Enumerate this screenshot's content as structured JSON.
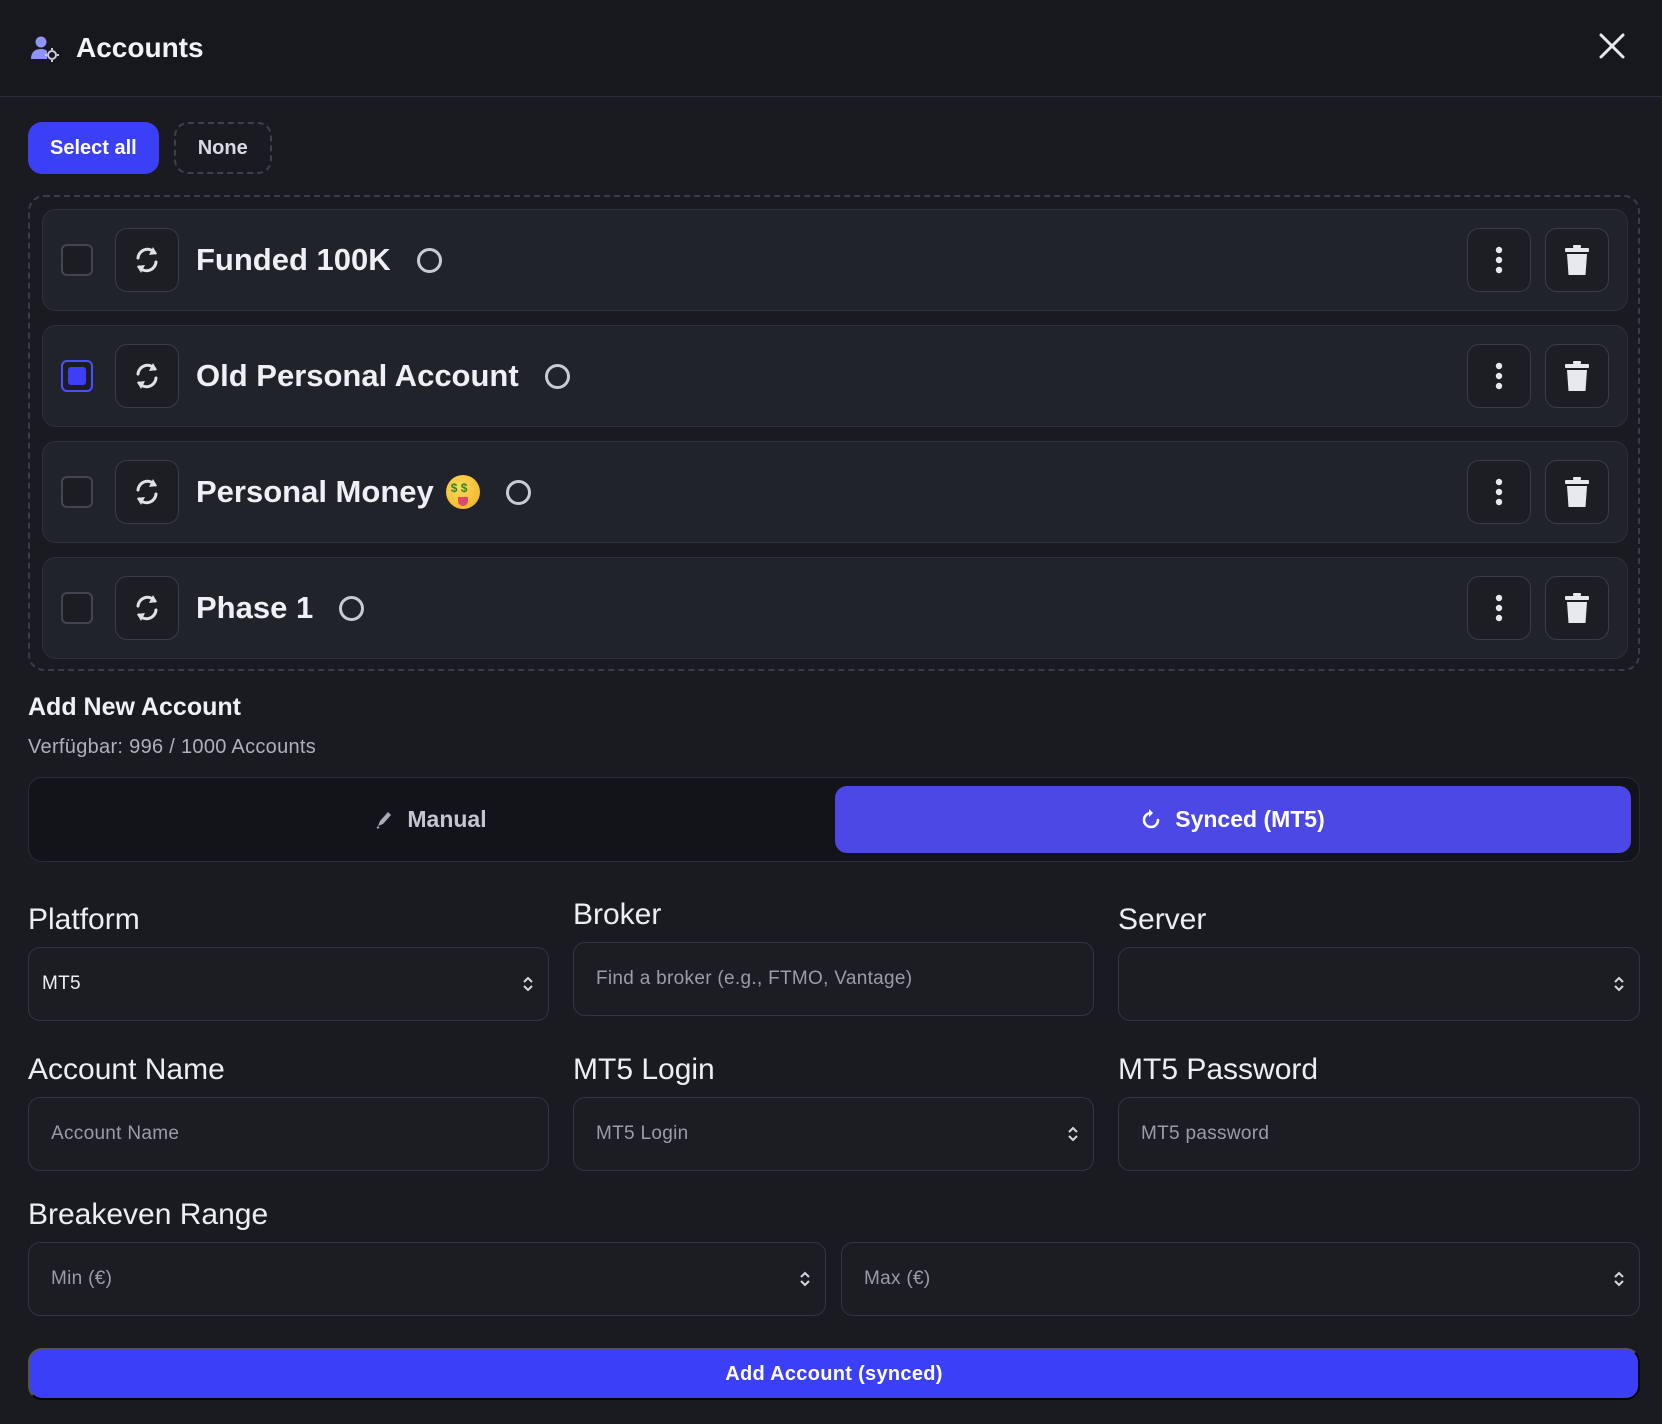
{
  "header": {
    "title": "Accounts",
    "icon": "users-gear-icon",
    "close_icon": "close-icon"
  },
  "selection": {
    "select_all_label": "Select all",
    "none_label": "None"
  },
  "accounts": [
    {
      "name": "Funded 100K",
      "checked": false,
      "emoji": false
    },
    {
      "name": "Old Personal Account",
      "checked": true,
      "emoji": false
    },
    {
      "name": "Personal Money",
      "checked": false,
      "emoji": true
    },
    {
      "name": "Phase 1",
      "checked": false,
      "emoji": false
    }
  ],
  "add": {
    "title": "Add New Account",
    "availability": "Verfügbar: 996 / 1000 Accounts",
    "mode_manual": "Manual",
    "mode_synced": "Synced (MT5)",
    "active_mode": "synced"
  },
  "form": {
    "platform_label": "Platform",
    "platform_value": "MT5",
    "broker_label": "Broker",
    "broker_placeholder": "Find a broker (e.g., FTMO, Vantage)",
    "server_label": "Server",
    "server_value": "",
    "account_name_label": "Account Name",
    "account_name_placeholder": "Account Name",
    "mt5_login_label": "MT5 Login",
    "mt5_login_placeholder": "MT5 Login",
    "mt5_password_label": "MT5 Password",
    "mt5_password_placeholder": "MT5 password",
    "breakeven_label": "Breakeven Range",
    "min_placeholder": "Min (€)",
    "max_placeholder": "Max (€)",
    "submit_label": "Add Account (synced)"
  },
  "colors": {
    "accent": "#3b3ff5",
    "synced_bg": "#4b48e6",
    "background": "#191b21"
  }
}
